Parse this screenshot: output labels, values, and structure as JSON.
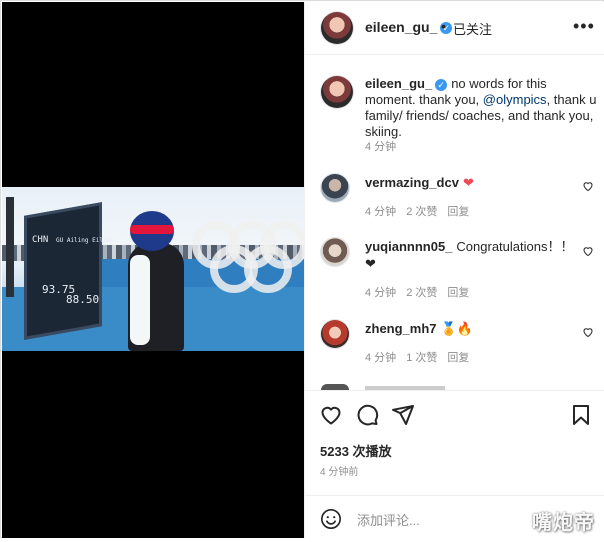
{
  "header": {
    "username": "eileen_gu_",
    "separator": "•",
    "follow_state": "已关注",
    "more": "•••"
  },
  "caption": {
    "username": "eileen_gu_",
    "text_before": "no words for this moment. thank you,",
    "mention": "@olympics",
    "text_after": ", thank u family/ friends/ coaches, and thank you, skiing.",
    "time": "4 分钟"
  },
  "comments": [
    {
      "username": "vermazing_dcv",
      "text": "❤",
      "time": "4 分钟",
      "likes": "2 次赞",
      "reply": "回复"
    },
    {
      "username": "yuqiannnn05_",
      "text": "Congratulations！！❤",
      "time": "4 分钟",
      "likes": "2 次赞",
      "reply": "回复"
    },
    {
      "username": "zheng_mh7",
      "text": "🏅🔥",
      "time": "4 分钟",
      "likes": "1 次赞",
      "reply": "回复"
    }
  ],
  "actions": {
    "views": "5233 次播放",
    "posted": "4 分钟前"
  },
  "add_comment": {
    "placeholder": "添加评论..."
  },
  "watermark": "嘴炮帝",
  "scoreboard": {
    "line1": "CHN",
    "line2": "GU Ailing Eileen",
    "score1": "93.75",
    "score2": "88.50"
  },
  "colors": {
    "verified": "#3897f0",
    "heart_red": "#ed4956",
    "mention": "#00376b",
    "muted": "#8e8e8e"
  }
}
